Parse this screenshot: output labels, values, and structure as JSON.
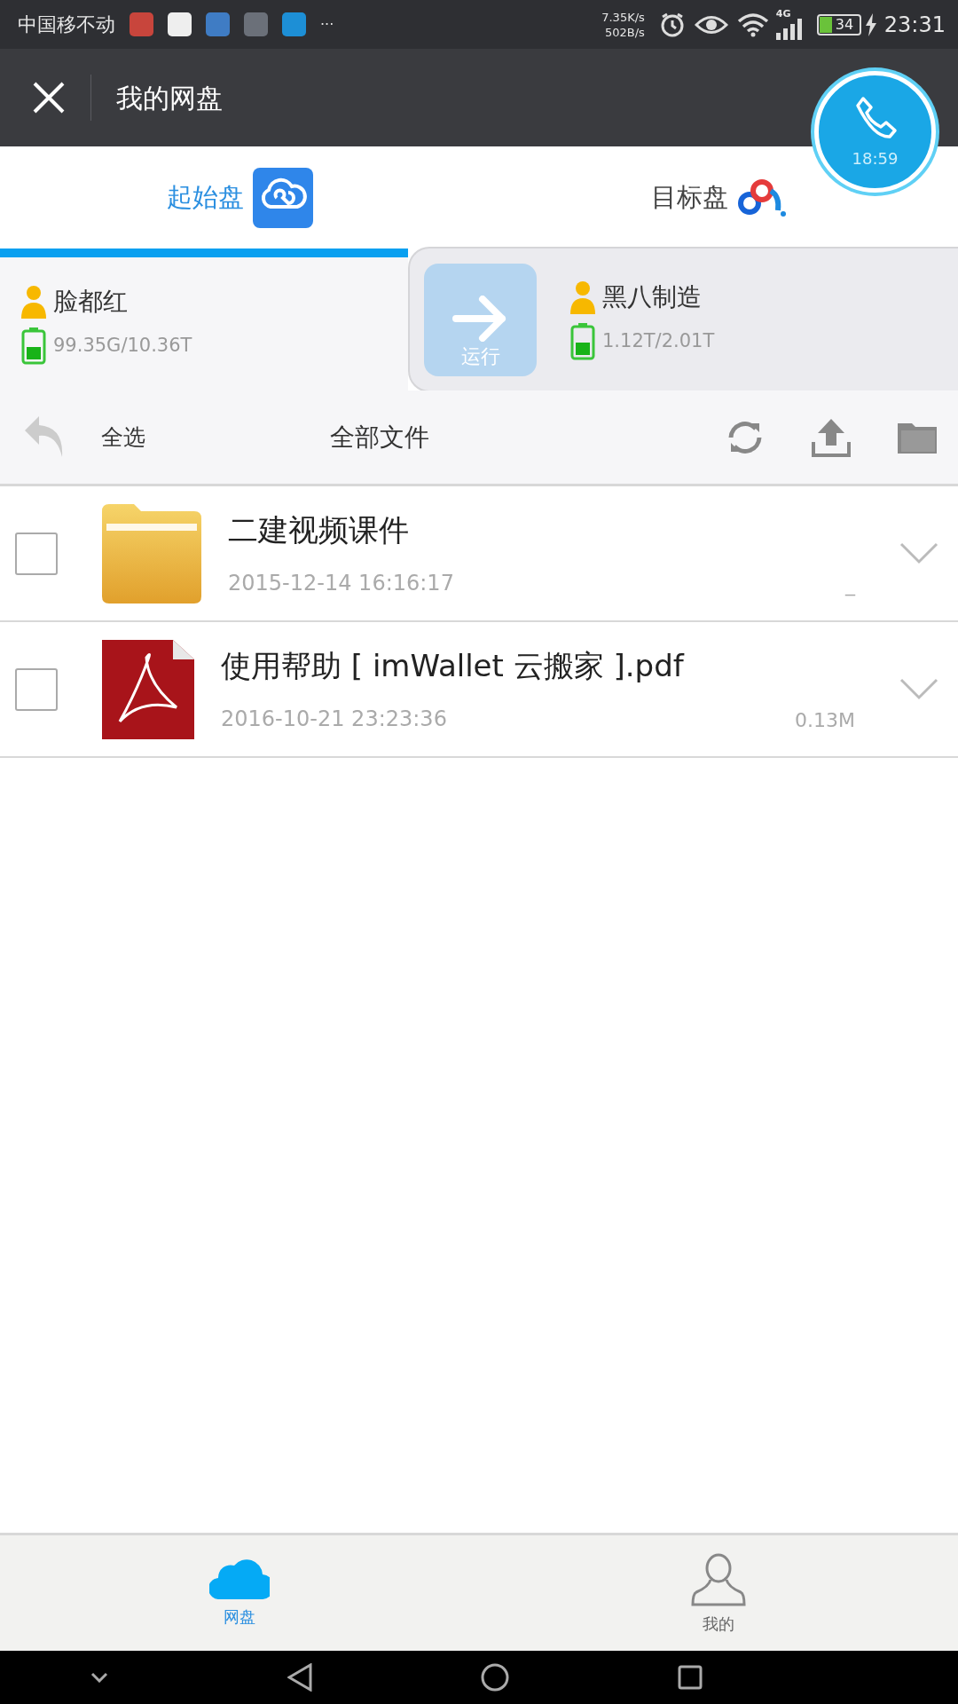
{
  "status_bar": {
    "carrier": "中国移不动",
    "more": "···",
    "speed_down": "7.35K/s",
    "speed_up": "502B/s",
    "network": "4G",
    "battery": "34",
    "time": "23:31"
  },
  "header": {
    "title": "我的网盘"
  },
  "call_bubble": {
    "time": "18:59"
  },
  "disk_tabs": [
    {
      "label": "起始盘",
      "selected": true
    },
    {
      "label": "目标盘",
      "selected": false
    }
  ],
  "accounts": [
    {
      "name": "脸都红",
      "usage": "99.35G/10.36T"
    },
    {
      "name": "黑八制造",
      "usage": "1.12T/2.01T"
    }
  ],
  "run_button": {
    "label": "运行",
    "disabled": true
  },
  "toolbar": {
    "select_all": "全选",
    "title": "全部文件"
  },
  "files": [
    {
      "kind": "folder",
      "name": "二建视频课件",
      "date": "2015-12-14 16:16:17",
      "size": "_",
      "checked": false
    },
    {
      "kind": "pdf",
      "name": "使用帮助 [ imWallet 云搬家 ].pdf",
      "date": "2016-10-21 23:23:36",
      "size": "0.13M",
      "checked": false
    }
  ],
  "bottom_nav": [
    {
      "kind": "cloud",
      "label": "网盘",
      "selected": true
    },
    {
      "kind": "person",
      "label": "我的",
      "selected": false
    }
  ]
}
